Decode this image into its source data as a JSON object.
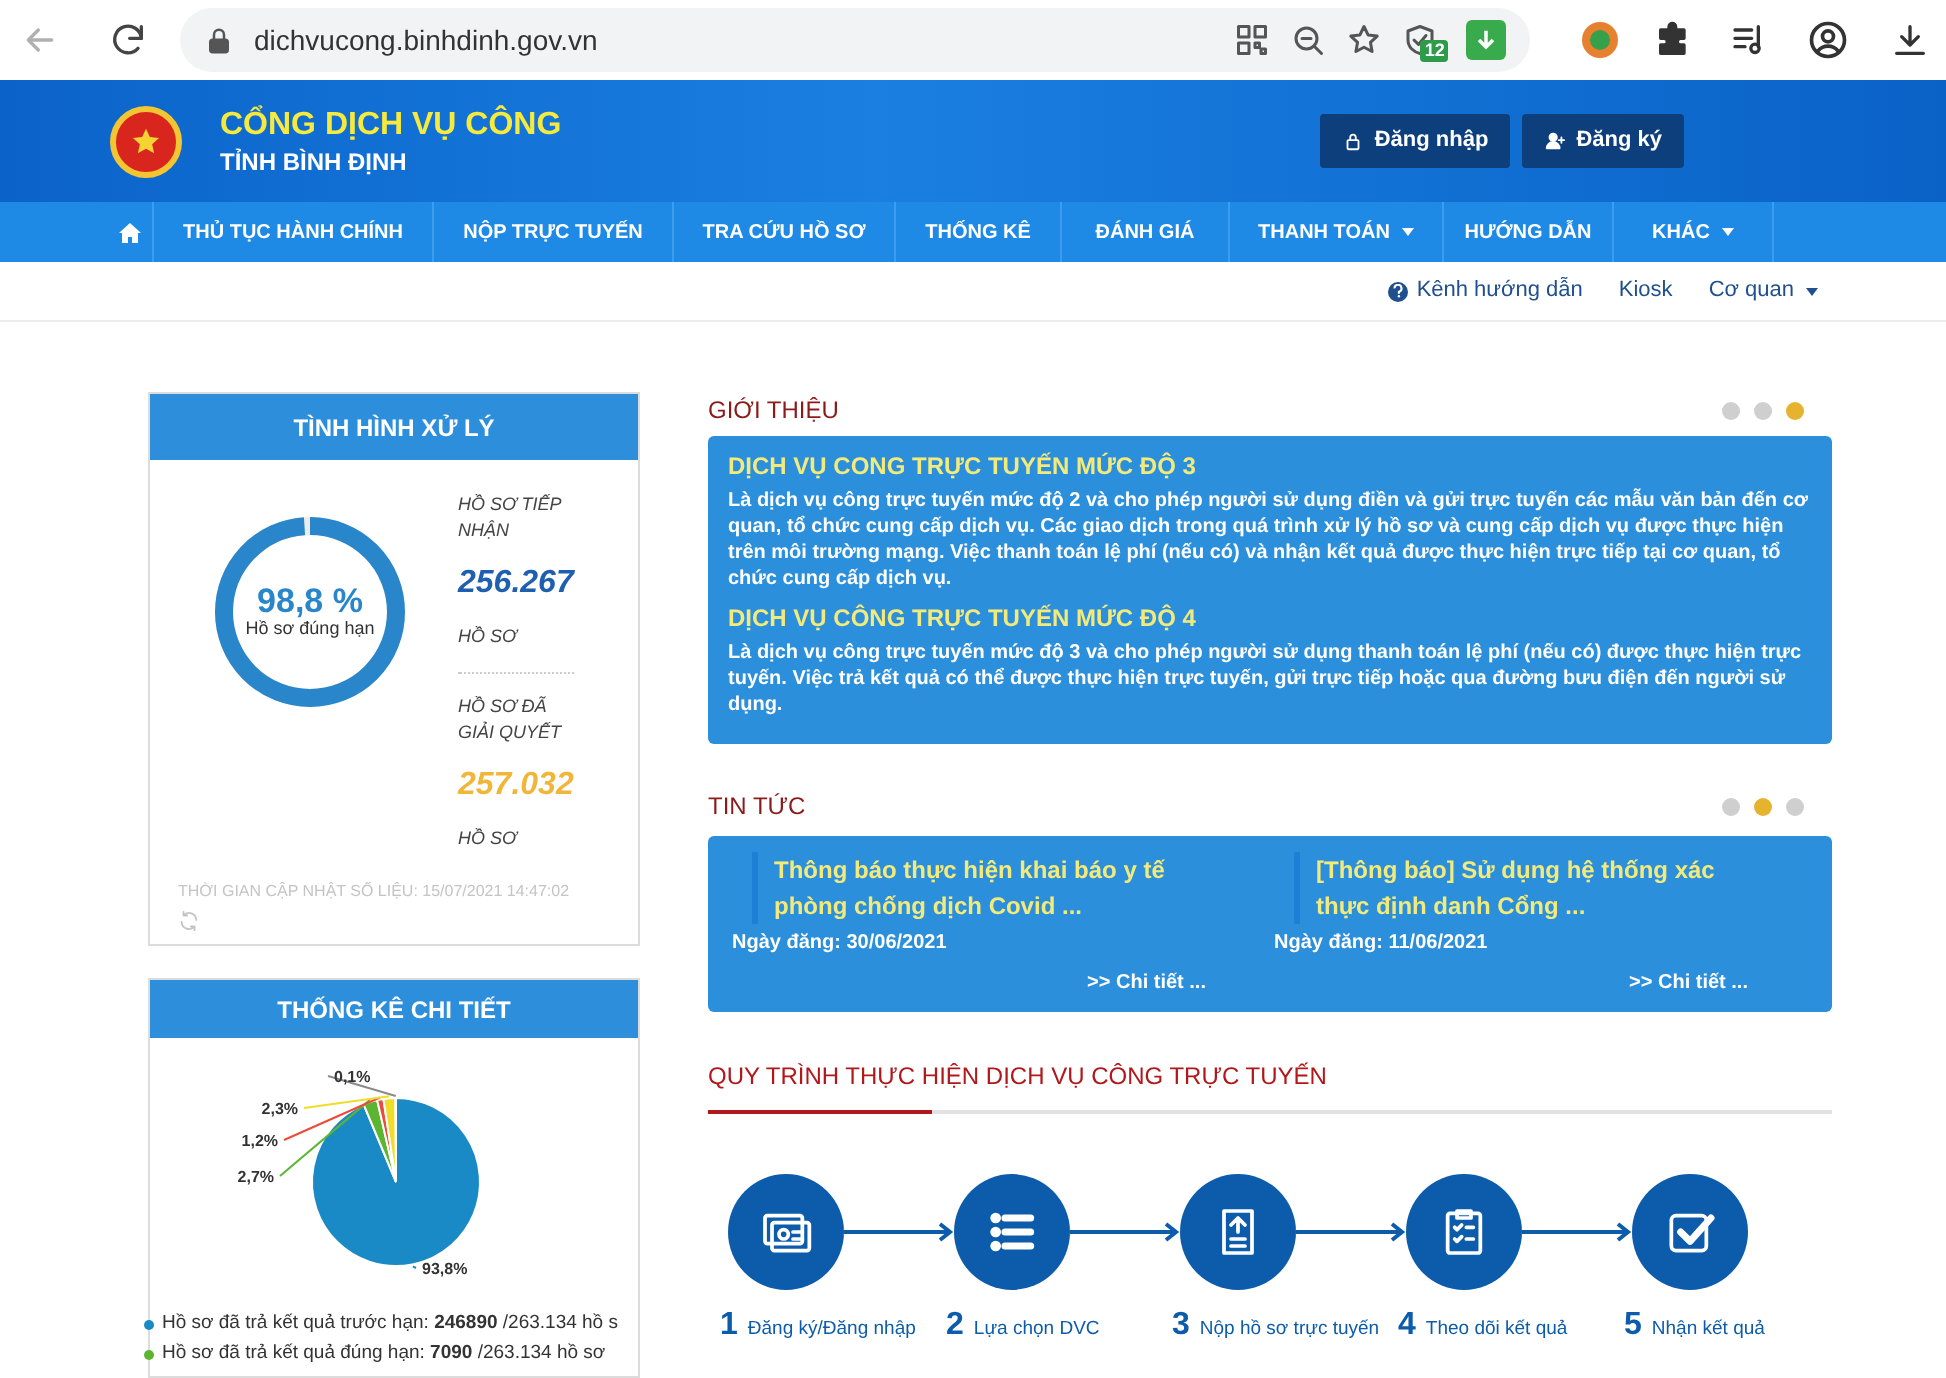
{
  "browser": {
    "url": "dichvucong.binhdinh.gov.vn",
    "back_disabled": true,
    "shield_badge": "12"
  },
  "header": {
    "title": "CỔNG DỊCH VỤ CÔNG",
    "subtitle": "TỈNH BÌNH ĐỊNH",
    "buttons": [
      {
        "kind": "login",
        "label": "Đăng nhập"
      },
      {
        "kind": "register",
        "label": "Đăng ký"
      }
    ]
  },
  "nav": [
    {
      "kind": "home"
    },
    {
      "kind": "link",
      "label": "THỦ TỤC HÀNH CHÍNH",
      "dropdown": false
    },
    {
      "kind": "link",
      "label": "NỘP TRỰC TUYẾN",
      "dropdown": false
    },
    {
      "kind": "link",
      "label": "TRA CỨU HỒ SƠ",
      "dropdown": false
    },
    {
      "kind": "link",
      "label": "THỐNG KÊ",
      "dropdown": false
    },
    {
      "kind": "link",
      "label": "ĐÁNH GIÁ",
      "dropdown": false
    },
    {
      "kind": "link",
      "label": "THANH TOÁN",
      "dropdown": true
    },
    {
      "kind": "link",
      "label": "HƯỚNG DẪN",
      "dropdown": false
    },
    {
      "kind": "link",
      "label": "KHÁC",
      "dropdown": true
    }
  ],
  "subnav": [
    {
      "kind": "help",
      "label": "Kênh hướng dẫn"
    },
    {
      "kind": "link",
      "label": "Kiosk"
    },
    {
      "kind": "dropdown",
      "label": "Cơ quan"
    }
  ],
  "status_panel": {
    "title": "TÌNH HÌNH XỬ LÝ",
    "donut": {
      "level": 0.988,
      "value": "98,8 %",
      "caption": "Hồ sơ đúng hạn"
    },
    "stats": [
      {
        "label": "HỒ SƠ TIẾP NHẬN",
        "value": "256.267",
        "unit": "HỒ SƠ",
        "color": "#1f5fb0"
      },
      {
        "label": "HỒ SƠ ĐÃ GIẢI QUYẾT",
        "value": "257.032",
        "unit": "HỒ SƠ",
        "color": "#f0b63a"
      }
    ],
    "updated": "THỜI GIAN CẬP NHẬT SỐ LIỆU: 15/07/2021 14:47:02"
  },
  "stats_panel": {
    "title": "THỐNG KÊ CHI TIẾT",
    "chart_data": {
      "type": "pie",
      "values": [
        93.8,
        2.7,
        1.2,
        2.3,
        0.1
      ],
      "value_labels": [
        "93,8%",
        "2,7%",
        "1,2%",
        "2,3%",
        "0,1%"
      ]
    },
    "legend": [
      {
        "color": "#1a8ac6",
        "text": "Hồ sơ đã trả kết quả trước hạn: **246890** /263.134 hồ s"
      },
      {
        "color": "#5cb531",
        "text": "Hồ sơ đã trả kết quả đúng hạn: **7090** /263.134 hồ sơ"
      }
    ]
  },
  "intro": {
    "title": "GIỚI THIỆU",
    "pages": [
      {
        "selected": false
      },
      {
        "selected": false
      },
      {
        "selected": true
      }
    ],
    "items": [
      {
        "heading": "DỊCH VỤ CONG TRỰC TUYẾN MỨC ĐỘ 3",
        "body": "Là dịch vụ công trực tuyến mức độ 2 và cho phép người sử dụng điền và gửi trực tuyến các mẫu văn bản đến cơ quan, tổ chức cung cấp dịch vụ. Các giao dịch trong quá trình xử lý hồ sơ và cung cấp dịch vụ được thực hiện trên môi trường mạng. Việc thanh toán lệ phí (nếu có) và nhận kết quả được thực hiện trực tiếp tại cơ quan, tổ chức cung cấp dịch vụ."
      },
      {
        "heading": "DỊCH VỤ CÔNG TRỰC TUYẾN MỨC ĐỘ 4",
        "body": "Là dịch vụ công trực tuyến mức độ 3 và cho phép người sử dụng thanh toán lệ phí (nếu có) được thực hiện trực tuyến. Việc trả kết quả có thể được thực hiện trực tuyến, gửi trực tiếp hoặc qua đường bưu điện đến người sử dụng."
      }
    ]
  },
  "news": {
    "title": "TIN TỨC",
    "pages": [
      {
        "selected": false
      },
      {
        "selected": true
      },
      {
        "selected": false
      }
    ],
    "items": [
      {
        "title": "Thông báo thực hiện khai báo y tế phòng chống dịch Covid ...",
        "date": "Ngày đăng: 30/06/2021",
        "more": ">> Chi tiết ..."
      },
      {
        "title": "[Thông báo] Sử dụng hệ thống xác thực định danh Cổng ...",
        "date": "Ngày đăng: 11/06/2021",
        "more": ">> Chi tiết ..."
      }
    ]
  },
  "process": {
    "title": "QUY TRÌNH THỰC HIỆN DỊCH VỤ CÔNG TRỰC TUYẾN",
    "steps": [
      {
        "number": "1",
        "label": "Đăng ký/Đăng nhập",
        "kind": "card"
      },
      {
        "number": "2",
        "label": "Lựa chọn DVC",
        "kind": "list"
      },
      {
        "number": "3",
        "label": "Nộp hồ sơ trực tuyến",
        "kind": "upload"
      },
      {
        "number": "4",
        "label": "Theo dõi kết quả",
        "kind": "clipboard"
      },
      {
        "number": "5",
        "label": "Nhận kết quả",
        "kind": "check"
      }
    ]
  }
}
